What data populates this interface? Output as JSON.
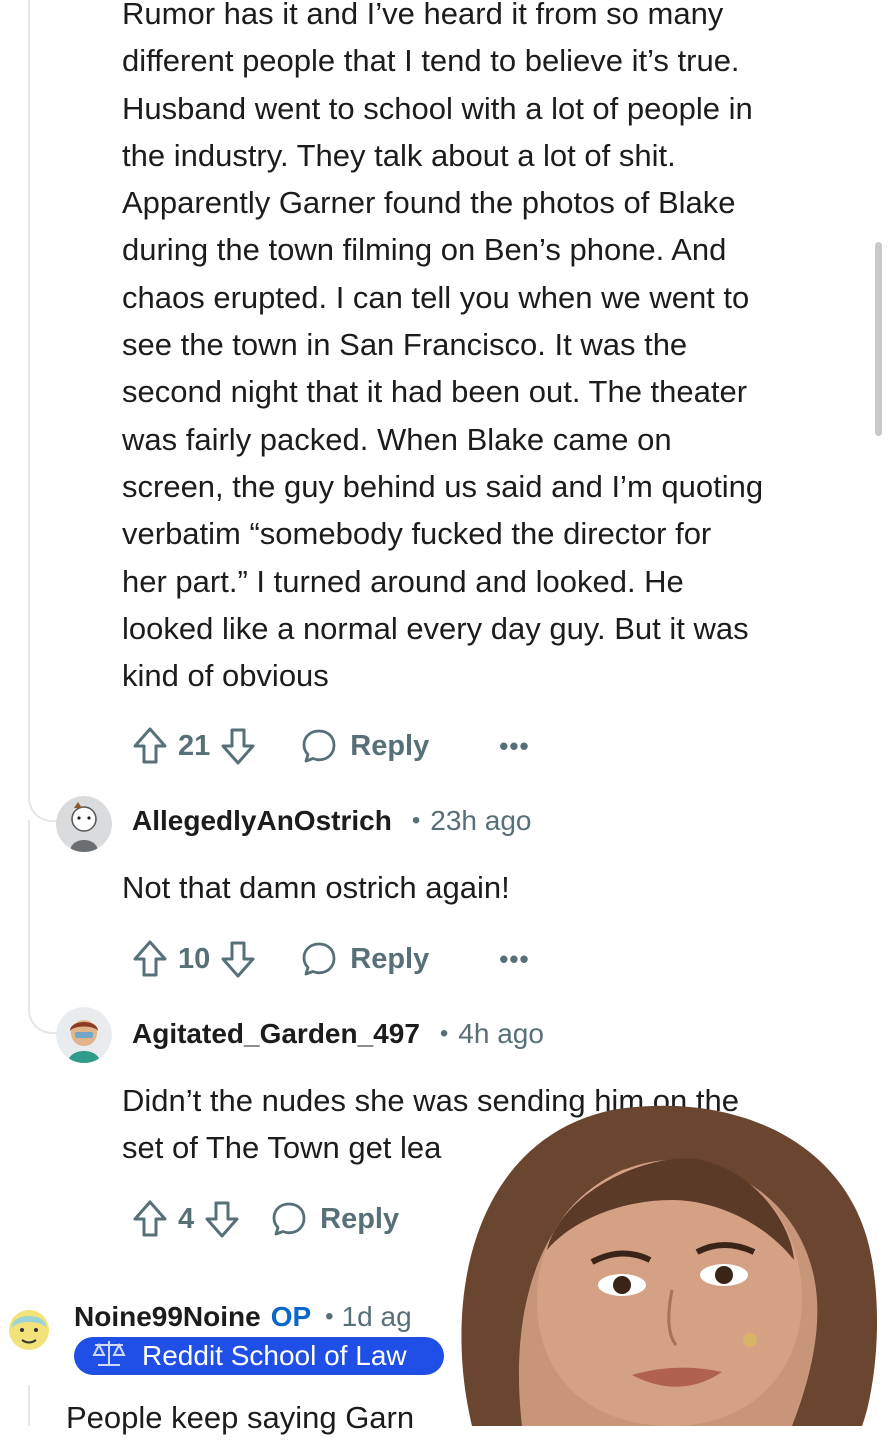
{
  "comment_main": {
    "body_lines": [
      "Rumor has it and I’ve heard it from so many",
      "different people that I tend to believe it’s true.",
      "Husband went to school with a lot of people in",
      "the industry. They talk about a lot of shit.",
      "Apparently Garner found the photos of Blake",
      "during the town filming on Ben’s phone. And",
      "chaos erupted. I can tell you when we went to",
      "see the town in San Francisco. It was the",
      "second night that it had been out. The theater",
      "was fairly packed. When Blake came on",
      "screen, the guy behind us said and I’m quoting",
      "verbatim “somebody fucked the director for",
      "her part.” I turned around and looked. He",
      "looked like a normal every day guy. But it was",
      "kind of obvious"
    ],
    "votes": "21",
    "reply_label": "Reply",
    "more_label": "•••"
  },
  "comment_ostrich": {
    "username": "AllegedlyAnOstrich",
    "separator": "•",
    "time": "23h ago",
    "body": "Not that damn ostrich again!",
    "votes": "10",
    "reply_label": "Reply",
    "more_label": "•••"
  },
  "comment_garden": {
    "username": "Agitated_Garden_497",
    "separator": "•",
    "time": "4h ago",
    "body_lines": [
      "Didn’t the nudes she was sending him on the",
      "set of The Town get lea"
    ],
    "votes": "4",
    "reply_label": "Reply"
  },
  "comment_op": {
    "username": "Noine99Noine",
    "op_badge": "OP",
    "separator": "•",
    "time": "1d ag",
    "flair_icon": "scales-icon",
    "flair": "Reddit School of Law",
    "body_partial": "People keep saying Garn"
  },
  "colors": {
    "meta_gray": "#576f76",
    "op_blue": "#0a66c8",
    "flair_blue": "#1f4fe6",
    "thread_line": "#e4e6e8"
  }
}
